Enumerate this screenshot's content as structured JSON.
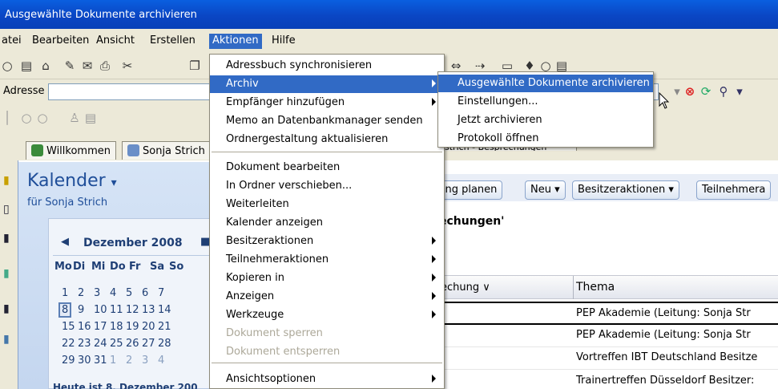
{
  "window": {
    "title": "Ausgewählte Dokumente archivieren"
  },
  "menubar": [
    "atei",
    "Bearbeiten",
    "Ansicht",
    "Erstellen",
    "Aktionen",
    "Hilfe"
  ],
  "address": {
    "label": "Adresse",
    "value": ""
  },
  "tabs": [
    "Willkommen",
    "Sonja Strich"
  ],
  "tab_hidden_text": "strich - Besprechungen",
  "calendar": {
    "title": "Kalender",
    "subtitle": "für Sonja Strich",
    "month": "Dezember 2008",
    "weekdays": [
      "Mo",
      "Di",
      "Mi",
      "Do",
      "Fr",
      "Sa",
      "So"
    ],
    "weeks": [
      [
        "1",
        "2",
        "3",
        "4",
        "5",
        "6",
        "7"
      ],
      [
        "8",
        "9",
        "10",
        "11",
        "12",
        "13",
        "14"
      ],
      [
        "15",
        "16",
        "17",
        "18",
        "19",
        "20",
        "21"
      ],
      [
        "22",
        "23",
        "24",
        "25",
        "26",
        "27",
        "28"
      ],
      [
        "29",
        "30",
        "31",
        "1",
        "2",
        "3",
        "4"
      ]
    ],
    "footer": "Heute ist 8. Dezember 200"
  },
  "actions": {
    "buttons": [
      "hung planen",
      "Neu ▾",
      "Besitzeraktionen ▾",
      "Teilnehmera"
    ]
  },
  "view": {
    "heading": "echungen'",
    "columns": [
      "echung ∨",
      "Thema"
    ],
    "rows": [
      "PEP Akademie (Leitung: Sonja Str",
      "PEP Akademie (Leitung: Sonja Str",
      "Vortreffen IBT Deutschland Besitze",
      "Trainertreffen Düsseldorf  Besitzer:"
    ]
  },
  "menu": {
    "items": [
      {
        "label": "Adressbuch synchronisieren"
      },
      {
        "label": "Archiv",
        "submenu": true,
        "highlight": true
      },
      {
        "label": "Empfänger hinzufügen",
        "submenu": true
      },
      {
        "label": "Memo an Datenbankmanager senden"
      },
      {
        "label": "Ordnergestaltung aktualisieren"
      },
      {
        "label": "Dokument bearbeiten"
      },
      {
        "label": "In Ordner verschieben..."
      },
      {
        "label": "Weiterleiten"
      },
      {
        "label": "Kalender anzeigen"
      },
      {
        "label": "Besitzeraktionen",
        "submenu": true
      },
      {
        "label": "Teilnehmeraktionen",
        "submenu": true
      },
      {
        "label": "Kopieren in",
        "submenu": true
      },
      {
        "label": "Anzeigen",
        "submenu": true
      },
      {
        "label": "Werkzeuge",
        "submenu": true
      },
      {
        "label": "Dokument sperren",
        "disabled": true
      },
      {
        "label": "Dokument entsperren",
        "disabled": true
      },
      {
        "label": "Ansichtsoptionen",
        "submenu": true
      }
    ]
  },
  "submenu": {
    "items": [
      "Ausgewählte Dokumente archivieren",
      "Einstellungen...",
      "Jetzt archivieren",
      "Protokoll öffnen"
    ]
  },
  "colors": {
    "highlight": "#316ac5",
    "titlebar": "#0a46c4"
  }
}
